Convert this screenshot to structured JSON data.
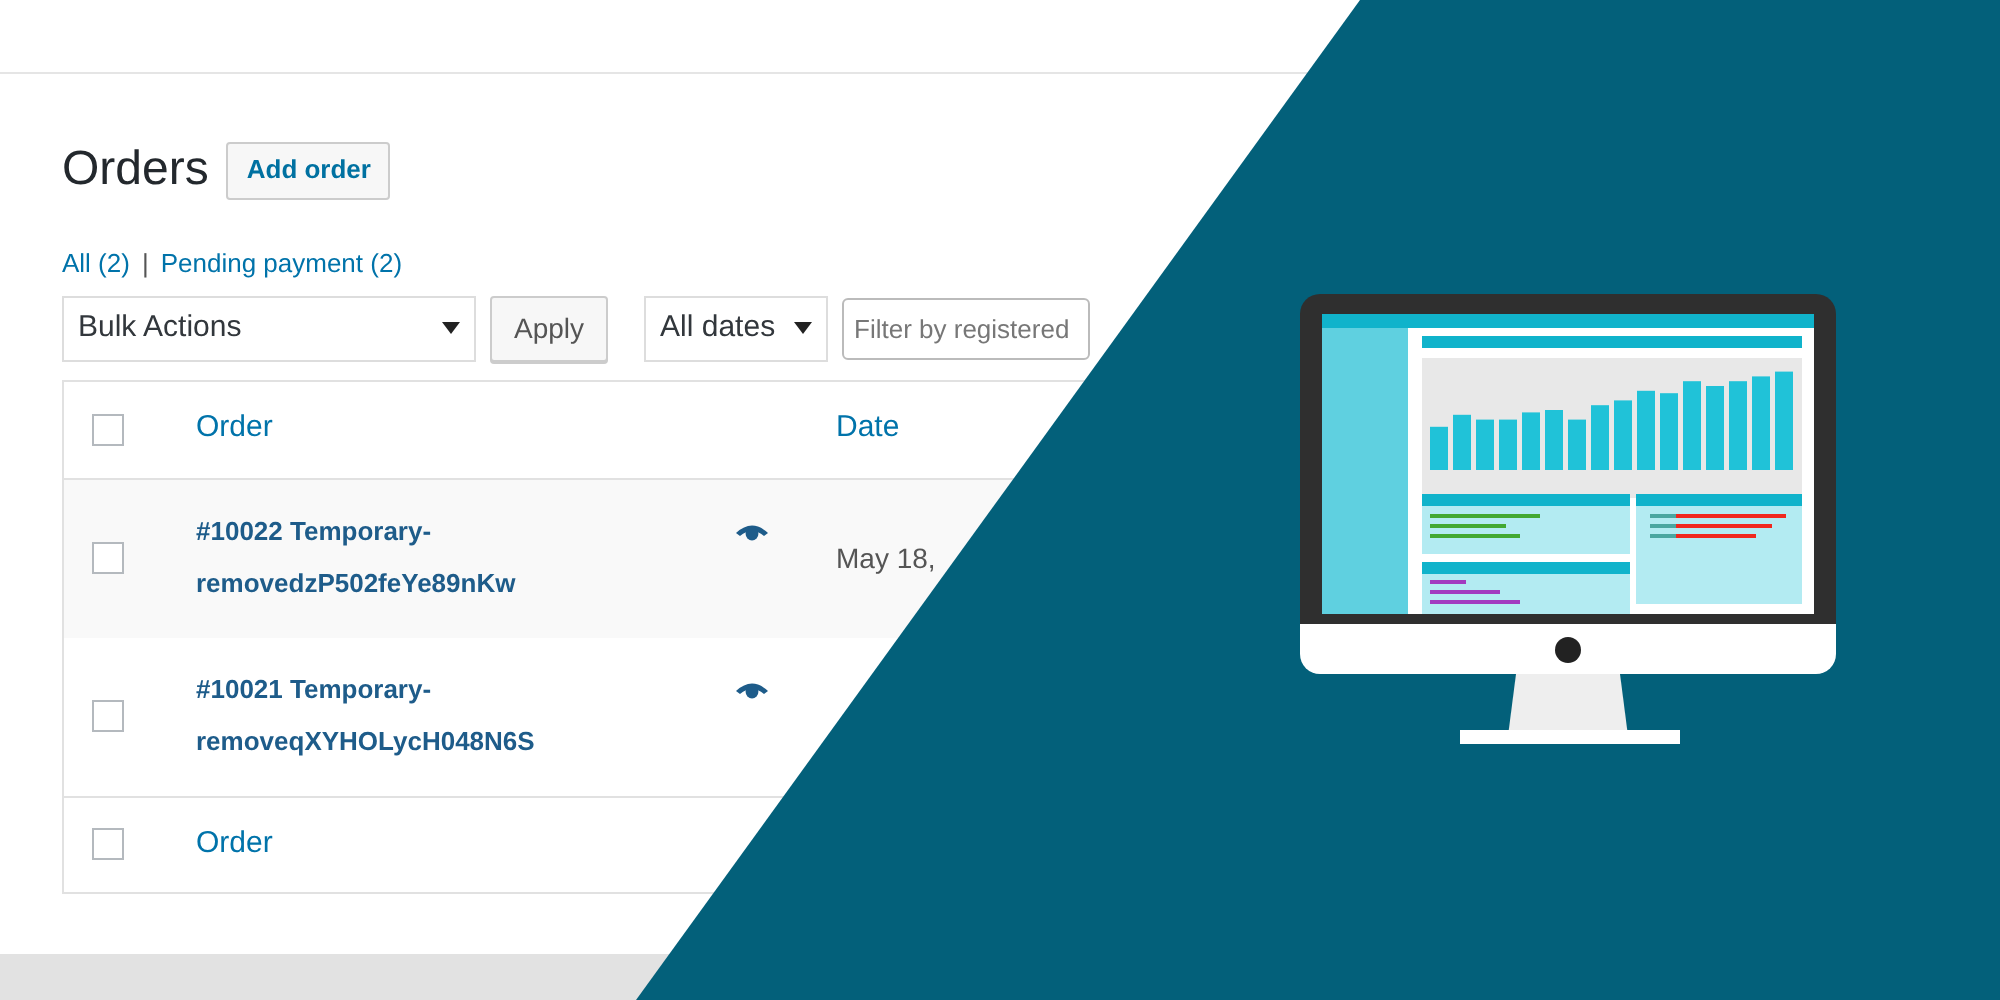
{
  "page": {
    "title": "Orders",
    "add_button": "Add order"
  },
  "filters": [
    {
      "label": "All",
      "count": "(2)"
    },
    {
      "label": "Pending payment",
      "count": "(2)"
    }
  ],
  "filter_separator": "|",
  "toolbar": {
    "bulk_actions": "Bulk Actions",
    "apply": "Apply",
    "dates": "All dates",
    "customer_filter": {
      "placeholder": "Filter by registered"
    }
  },
  "table": {
    "columns": [
      "Order",
      "Date"
    ],
    "rows": [
      {
        "order": "#10022 Temporary-removedzP502feYe89nKw",
        "date": "May 18,",
        "checked": false
      },
      {
        "order": "#10021 Temporary-removeqXYHOLycH048N6S",
        "checked": false
      }
    ],
    "footer_columns": [
      "Order"
    ],
    "select_all_checked": false,
    "footer_select_checked": false
  }
}
